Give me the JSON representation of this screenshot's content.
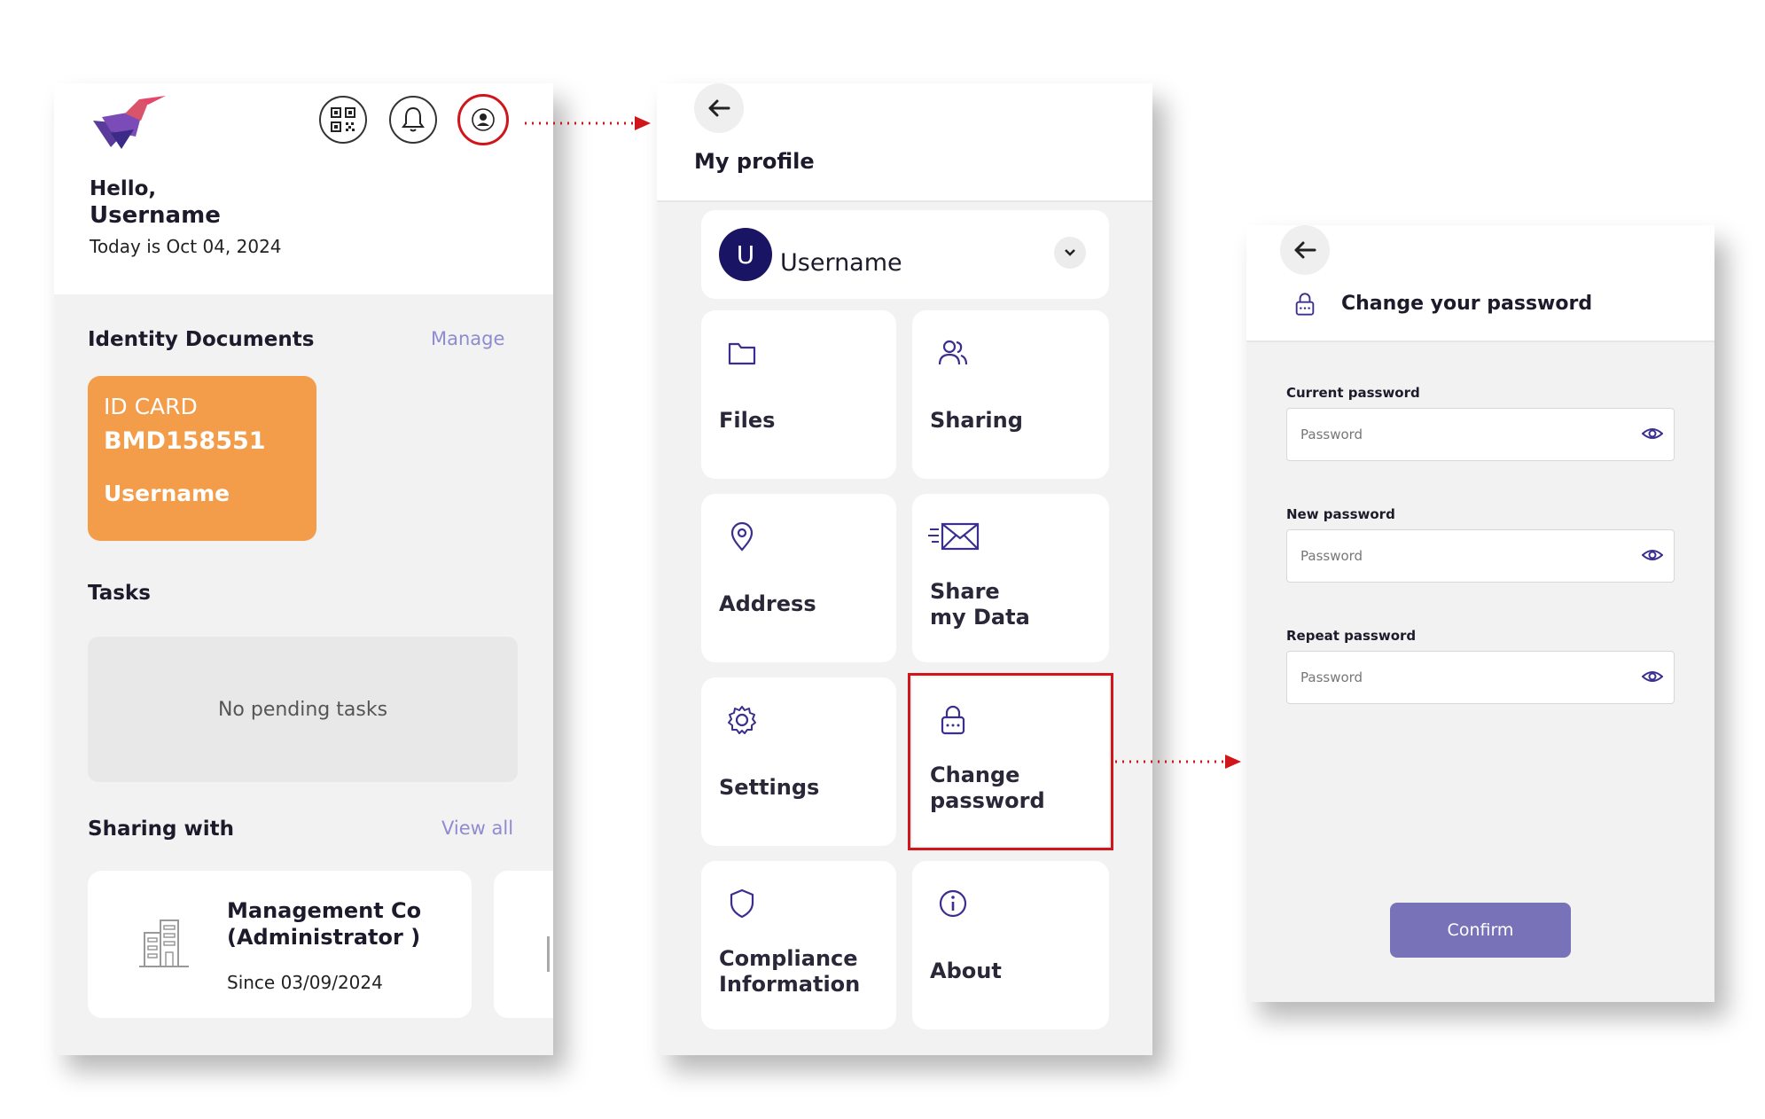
{
  "home": {
    "greeting": "Hello,",
    "username": "Username",
    "date_text": "Today is Oct 04, 2024",
    "identity_title": "Identity Documents",
    "manage_link": "Manage",
    "id_card": {
      "type": "ID CARD",
      "number": "BMD158551",
      "holder": "Username"
    },
    "tasks_title": "Tasks",
    "tasks_empty": "No pending tasks",
    "sharing_title": "Sharing with",
    "view_all_link": "View all",
    "sharing_item": {
      "name": "Management Co\n(Administrator )",
      "since": "Since 03/09/2024"
    }
  },
  "profile": {
    "title": "My profile",
    "avatar_letter": "U",
    "username": "Username",
    "tiles": [
      {
        "label": "Files",
        "icon": "folder-icon"
      },
      {
        "label": "Sharing",
        "icon": "users-icon"
      },
      {
        "label": "Address",
        "icon": "location-pin-icon"
      },
      {
        "label": "Share\nmy Data",
        "icon": "envelope-icon"
      },
      {
        "label": "Settings",
        "icon": "gear-icon"
      },
      {
        "label": "Change\npassword",
        "icon": "lock-icon"
      },
      {
        "label": "Compliance\nInformation",
        "icon": "shield-icon"
      },
      {
        "label": "About",
        "icon": "info-icon"
      }
    ]
  },
  "change_password": {
    "title": "Change your password",
    "fields": [
      {
        "label": "Current password",
        "placeholder": "Password"
      },
      {
        "label": "New password",
        "placeholder": "Password"
      },
      {
        "label": "Repeat password",
        "placeholder": "Password"
      }
    ],
    "confirm_label": "Confirm"
  },
  "colors": {
    "accent": "#8f8bd0",
    "id_card": "#f39c4a",
    "highlight": "#d0161b",
    "confirm_button": "#7872b8",
    "icon_purple": "#3a2e8f",
    "avatar": "#1a1464"
  }
}
